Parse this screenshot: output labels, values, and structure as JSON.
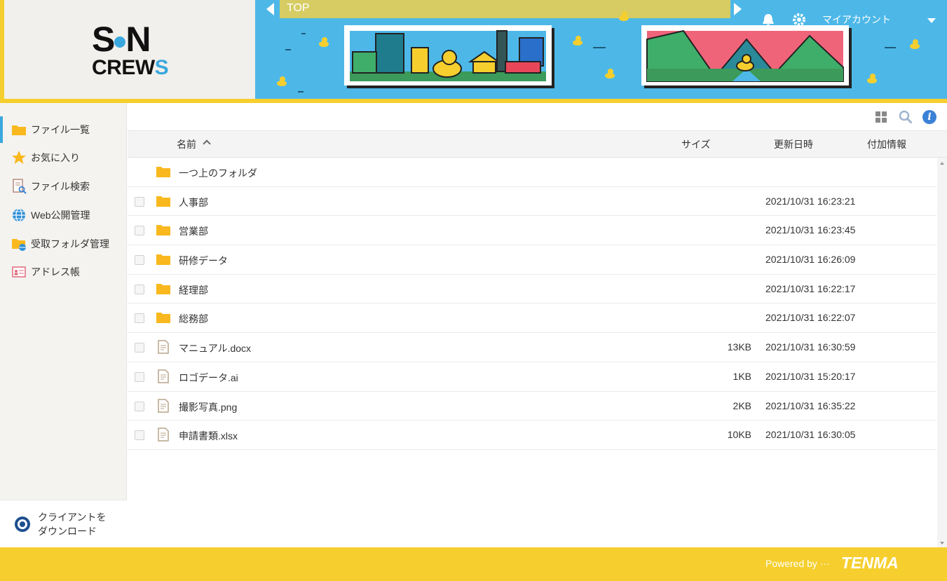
{
  "logo": {
    "line1_a": "S",
    "line1_b": "N",
    "line2_a": "CREW",
    "line2_b": "S"
  },
  "header": {
    "breadcrumb": "TOP",
    "account_label": "マイアカウント",
    "colors": {
      "sky": "#4db8e8",
      "accent_yellow": "#f6cf2e",
      "breadcrumb_bar": "#d6cc63"
    }
  },
  "toolbar": {
    "icons": [
      "grid-view-icon",
      "search-icon",
      "info-icon"
    ],
    "info_glyph": "i"
  },
  "sidebar": {
    "items": [
      {
        "label": "ファイル一覧",
        "icon": "folder-icon",
        "active": true
      },
      {
        "label": "お気に入り",
        "icon": "star-icon",
        "active": false
      },
      {
        "label": "ファイル検索",
        "icon": "file-search-icon",
        "active": false
      },
      {
        "label": "Web公開管理",
        "icon": "globe-icon",
        "active": false
      },
      {
        "label": "受取フォルダ管理",
        "icon": "receive-folder-icon",
        "active": false
      },
      {
        "label": "アドレス帳",
        "icon": "address-book-icon",
        "active": false
      }
    ],
    "client_download": {
      "line1": "クライアントを",
      "line2": "ダウンロード"
    }
  },
  "table": {
    "headers": {
      "name": "名前",
      "size": "サイズ",
      "modified": "更新日時",
      "extra": "付加情報"
    },
    "parent_folder": "一つ上のフォルダ",
    "rows": [
      {
        "type": "folder",
        "name": "人事部",
        "size": "",
        "modified": "2021/10/31 16:23:21"
      },
      {
        "type": "folder",
        "name": "営業部",
        "size": "",
        "modified": "2021/10/31 16:23:45"
      },
      {
        "type": "folder",
        "name": "研修データ",
        "size": "",
        "modified": "2021/10/31 16:26:09"
      },
      {
        "type": "folder",
        "name": "経理部",
        "size": "",
        "modified": "2021/10/31 16:22:17"
      },
      {
        "type": "folder",
        "name": "総務部",
        "size": "",
        "modified": "2021/10/31 16:22:07"
      },
      {
        "type": "file",
        "name": "マニュアル.docx",
        "size": "13KB",
        "modified": "2021/10/31 16:30:59"
      },
      {
        "type": "file",
        "name": "ロゴデータ.ai",
        "size": "1KB",
        "modified": "2021/10/31 15:20:17"
      },
      {
        "type": "file",
        "name": "撮影写真.png",
        "size": "2KB",
        "modified": "2021/10/31 16:35:22"
      },
      {
        "type": "file",
        "name": "申請書類.xlsx",
        "size": "10KB",
        "modified": "2021/10/31 16:30:05"
      }
    ]
  },
  "footer": {
    "powered_by": "Powered by ···",
    "brand": "TENMA"
  }
}
